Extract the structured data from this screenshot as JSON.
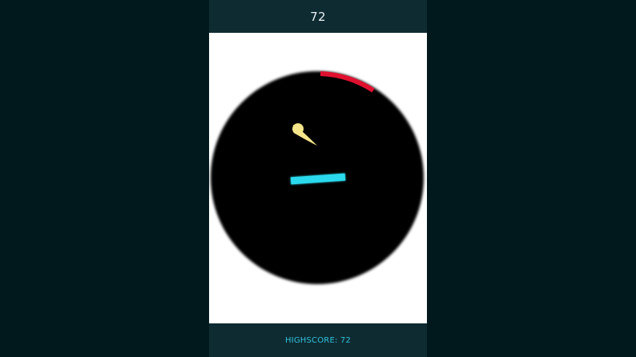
{
  "hud": {
    "score": "72",
    "highscore_label": "HIGHSCORE: 72"
  },
  "colors": {
    "outer_background": "#01191d",
    "panel": "#0f2b32",
    "play_background": "#ffffff",
    "arena": "#000000",
    "target_arc": "#e0102f",
    "ball": "#f5e58a",
    "paddle": "#2ad9ee",
    "score_text": "#e9f1f2",
    "highscore_text": "#2ec4dd"
  },
  "icons": {
    "ball": "comet-ball-icon"
  }
}
